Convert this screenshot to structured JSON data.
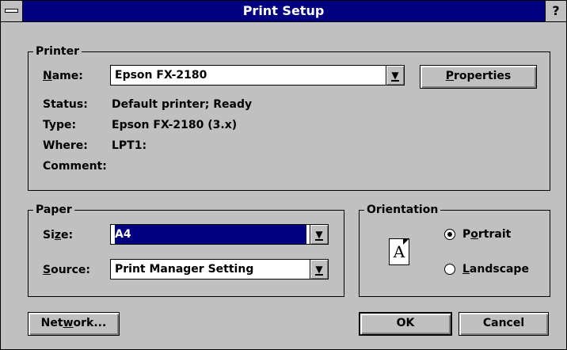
{
  "window": {
    "title": "Print Setup",
    "help_label": "?"
  },
  "printer": {
    "group_label": "Printer",
    "name_label_u": "N",
    "name_label_rest": "ame:",
    "name_value": "Epson FX-2180",
    "properties_u": "P",
    "properties_rest": "roperties",
    "status_label": "Status:",
    "status_value": "Default printer; Ready",
    "type_label": "Type:",
    "type_value": "Epson FX-2180 (3.x)",
    "where_label": "Where:",
    "where_value": "LPT1:",
    "comment_label": "Comment:",
    "comment_value": ""
  },
  "paper": {
    "group_label": "Paper",
    "size_label_pre": "Si",
    "size_label_u": "z",
    "size_label_rest": "e:",
    "size_value": "A4",
    "source_label_u": "S",
    "source_label_rest": "ource:",
    "source_value": "Print Manager Setting"
  },
  "orientation": {
    "group_label": "Orientation",
    "icon_letter": "A",
    "portrait_pre": "P",
    "portrait_u": "o",
    "portrait_rest": "rtrait",
    "landscape_pre": "",
    "landscape_u": "L",
    "landscape_rest": "andscape",
    "selected": "portrait"
  },
  "buttons": {
    "network_pre": "Net",
    "network_u": "w",
    "network_rest": "ork...",
    "ok": "OK",
    "cancel": "Cancel"
  },
  "icons": {
    "dropdown": "dropdown-arrow-icon",
    "system_menu": "system-menu-icon",
    "page": "portrait-page-icon"
  },
  "colors": {
    "titlebar": "#000080",
    "face": "#c0c0c0",
    "selection": "#000080"
  }
}
